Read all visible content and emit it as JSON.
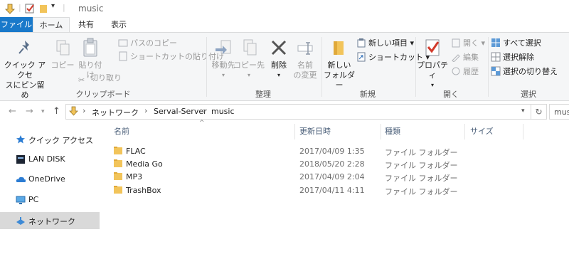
{
  "window": {
    "title": "music"
  },
  "ribbon": {
    "tabs": [
      "ファイル",
      "ホーム",
      "共有",
      "表示"
    ],
    "clipboard": {
      "pin_label_1": "クイック アクセ",
      "pin_label_2": "スにピン留め",
      "copy": "コピー",
      "paste": "貼り付け",
      "copy_path": "パスのコピー",
      "paste_shortcut": "ショートカットの貼り付け",
      "cut": "切り取り",
      "group": "クリップボード"
    },
    "organize": {
      "move_to": "移動先",
      "copy_to": "コピー先",
      "delete": "削除",
      "rename_1": "名前",
      "rename_2": "の変更",
      "group": "整理"
    },
    "new": {
      "new_folder_1": "新しい",
      "new_folder_2": "フォルダー",
      "new_item": "新しい項目",
      "shortcut": "ショートカット",
      "group": "新規"
    },
    "open": {
      "properties": "プロパティ",
      "open": "開く",
      "edit": "編集",
      "history": "履歴",
      "group": "開く"
    },
    "select": {
      "select_all": "すべて選択",
      "select_none": "選択解除",
      "invert": "選択の切り替え",
      "group": "選択"
    }
  },
  "address": {
    "crumbs": [
      "ネットワーク",
      "Serval-Server",
      "music"
    ],
    "search_text": "mus"
  },
  "navpane": {
    "items": [
      {
        "label": "クイック アクセス",
        "icon": "star-icon"
      },
      {
        "label": "LAN DISK",
        "icon": "lan-disk-icon"
      },
      {
        "label": "OneDrive",
        "icon": "cloud-icon"
      },
      {
        "label": "PC",
        "icon": "pc-icon"
      },
      {
        "label": "ネットワーク",
        "icon": "network-icon"
      }
    ]
  },
  "filelist": {
    "columns": [
      "名前",
      "更新日時",
      "種類",
      "サイズ"
    ],
    "rows": [
      {
        "name": "FLAC",
        "date": "2017/04/09 1:35",
        "type": "ファイル フォルダー"
      },
      {
        "name": "Media Go",
        "date": "2018/05/20 2:28",
        "type": "ファイル フォルダー"
      },
      {
        "name": "MP3",
        "date": "2017/04/09 2:04",
        "type": "ファイル フォルダー"
      },
      {
        "name": "TrashBox",
        "date": "2017/04/11 4:11",
        "type": "ファイル フォルダー"
      }
    ]
  },
  "colors": {
    "file_tab": "#1979ca",
    "folder": "#f2c45a",
    "selected": "#d9d9d9"
  }
}
